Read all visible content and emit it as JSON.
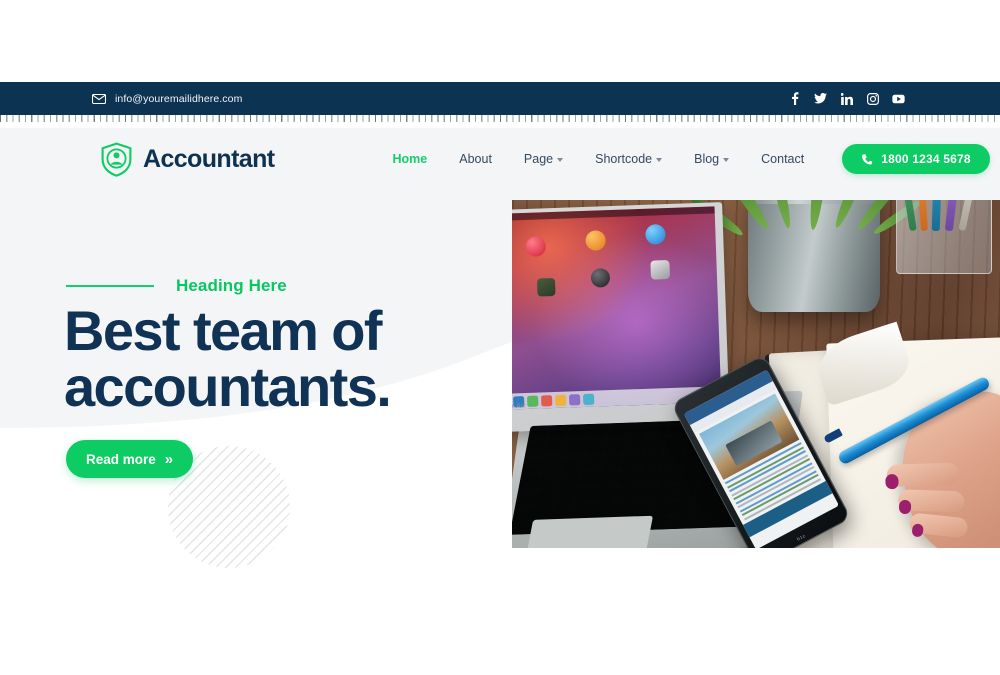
{
  "topbar": {
    "email": "info@youremailidhere.com",
    "email_icon": "envelope-icon",
    "social": [
      {
        "name": "facebook-icon",
        "label": "f"
      },
      {
        "name": "twitter-icon",
        "label": "t"
      },
      {
        "name": "linkedin-icon",
        "label": "in"
      },
      {
        "name": "instagram-icon",
        "label": "ig"
      },
      {
        "name": "youtube-icon",
        "label": "yt"
      }
    ],
    "bg_color": "#0d3353"
  },
  "header": {
    "logo_text": "Accountant",
    "logo_icon": "shield-user-icon",
    "nav": [
      {
        "label": "Home",
        "active": true,
        "dropdown": false
      },
      {
        "label": "About",
        "active": false,
        "dropdown": false
      },
      {
        "label": "Page",
        "active": false,
        "dropdown": true
      },
      {
        "label": "Shortcode",
        "active": false,
        "dropdown": true
      },
      {
        "label": "Blog",
        "active": false,
        "dropdown": true
      },
      {
        "label": "Contact",
        "active": false,
        "dropdown": false
      }
    ],
    "phone_label": "1800 1234 5678",
    "phone_icon": "phone-icon"
  },
  "hero": {
    "eyebrow": "Heading Here",
    "title_line1": "Best team of",
    "title_line2": "accountants.",
    "cta_label": "Read more",
    "cta_chevron": "»",
    "image_alt": "laptop-phone-notebook-desk-photo"
  },
  "colors": {
    "navy": "#0d3353",
    "heading_navy": "#103254",
    "green": "#0ccc63",
    "green_accent": "#13cf6e",
    "bg_grey": "#f4f5f7",
    "white": "#ffffff"
  }
}
